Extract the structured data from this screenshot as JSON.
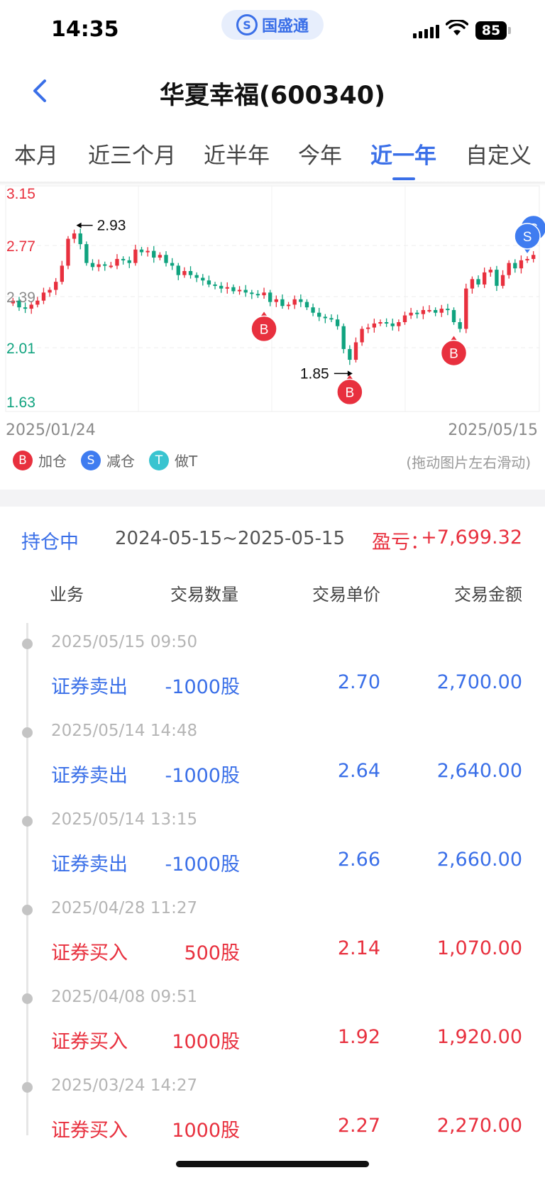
{
  "status_bar": {
    "time": "14:35",
    "app_name": "国盛通",
    "battery": "85"
  },
  "header": {
    "title": "华夏幸福(600340)"
  },
  "tabs": [
    {
      "label": "本月",
      "active": false
    },
    {
      "label": "近三个月",
      "active": false
    },
    {
      "label": "近半年",
      "active": false
    },
    {
      "label": "今年",
      "active": false
    },
    {
      "label": "近一年",
      "active": true
    },
    {
      "label": "自定义",
      "active": false
    }
  ],
  "chart": {
    "y_labels": [
      "3.15",
      "2.77",
      "2.39",
      "2.01",
      "1.63"
    ],
    "high_label": "2.93",
    "low_label": "1.85",
    "start_date": "2025/01/24",
    "end_date": "2025/05/15",
    "markers": {
      "buy": "B",
      "sell": "S"
    },
    "colors": {
      "up": "#e8303e",
      "down": "#10a37f",
      "buy_marker": "#e8303e",
      "sell_marker": "#3f7cf0"
    }
  },
  "legend": {
    "items": [
      {
        "symbol": "B",
        "label": "加仓",
        "color": "#e8303e"
      },
      {
        "symbol": "S",
        "label": "减仓",
        "color": "#3f7cf0"
      },
      {
        "symbol": "T",
        "label": "做T",
        "color": "#39c4d0"
      }
    ],
    "hint": "(拖动图片左右滑动)"
  },
  "summary": {
    "status": "持仓中",
    "range": "2024-05-15~2025-05-15",
    "pl_label": "盈亏：",
    "pl_value": "+7,699.32"
  },
  "table": {
    "headers": [
      "业务",
      "交易数量",
      "交易单价",
      "交易金额"
    ],
    "rows": [
      {
        "time": "2025/05/15 09:50",
        "business": "证券卖出",
        "quantity": "-1000股",
        "price": "2.70",
        "amount": "2,700.00",
        "side": "sell"
      },
      {
        "time": "2025/05/14 14:48",
        "business": "证券卖出",
        "quantity": "-1000股",
        "price": "2.64",
        "amount": "2,640.00",
        "side": "sell"
      },
      {
        "time": "2025/05/14 13:15",
        "business": "证券卖出",
        "quantity": "-1000股",
        "price": "2.66",
        "amount": "2,660.00",
        "side": "sell"
      },
      {
        "time": "2025/04/28 11:27",
        "business": "证券买入",
        "quantity": "500股",
        "price": "2.14",
        "amount": "1,070.00",
        "side": "buy"
      },
      {
        "time": "2025/04/08 09:51",
        "business": "证券买入",
        "quantity": "1000股",
        "price": "1.92",
        "amount": "1,920.00",
        "side": "buy"
      },
      {
        "time": "2025/03/24 14:27",
        "business": "证券买入",
        "quantity": "1000股",
        "price": "2.27",
        "amount": "2,270.00",
        "side": "buy"
      }
    ]
  }
}
